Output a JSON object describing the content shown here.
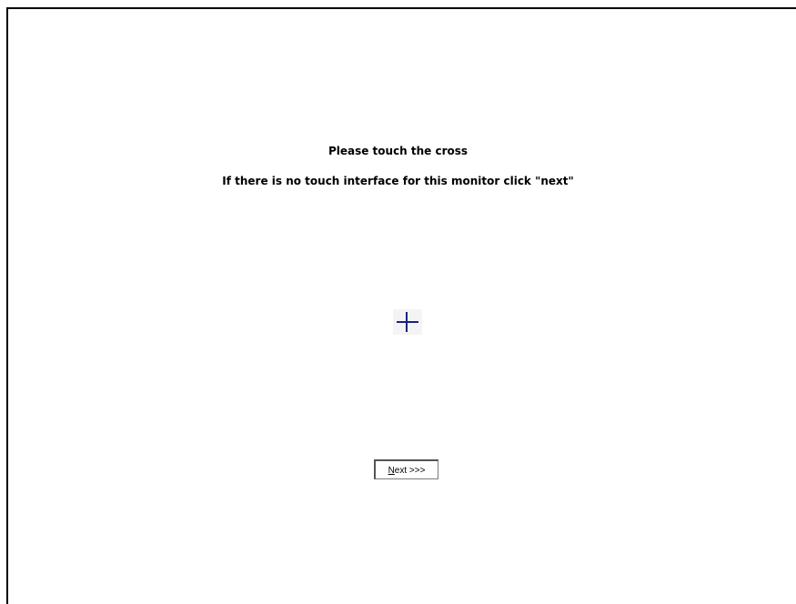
{
  "calibration": {
    "instruction_primary": "Please touch the cross",
    "instruction_secondary": "If there is no touch interface for this monitor click \"next\"",
    "cross_color": "#1a237e",
    "next_button": {
      "mnemonic": "N",
      "label_rest": "ext >>>"
    }
  }
}
